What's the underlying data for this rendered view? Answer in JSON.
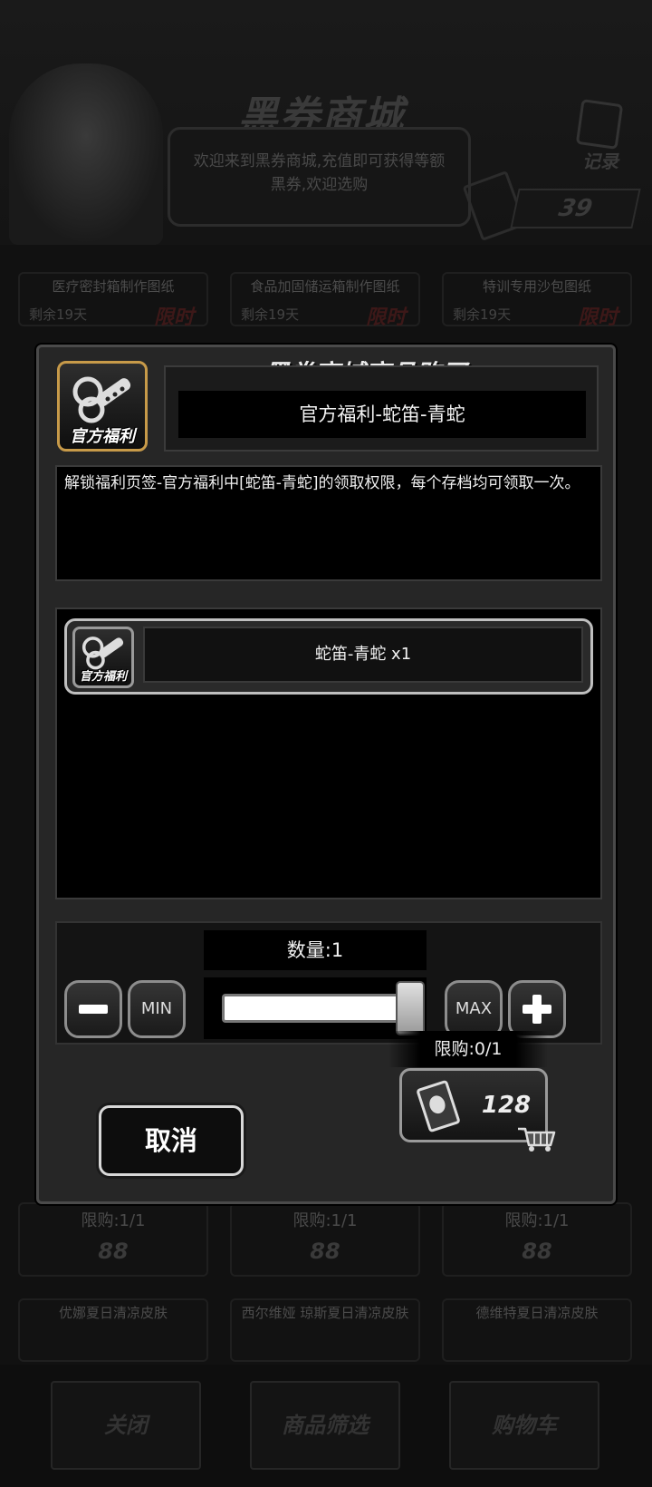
{
  "background": {
    "shop_title": "黑券商城",
    "welcome_text": "欢迎来到黑券商城,充值即可获得等额黑券,欢迎选购",
    "record_label": "记录",
    "ticket_balance": "39",
    "cards_row1": [
      {
        "title": "医疗密封箱制作图纸",
        "days": "剩余19天",
        "tag": "限时"
      },
      {
        "title": "食品加固储运箱制作图纸",
        "days": "剩余19天",
        "tag": "限时"
      },
      {
        "title": "特训专用沙包图纸",
        "days": "剩余19天",
        "tag": "限时"
      }
    ],
    "cards_price_row": [
      {
        "limit": "限购:1/1",
        "price": "88"
      },
      {
        "limit": "限购:1/1",
        "price": "88"
      },
      {
        "limit": "限购:1/1",
        "price": "88"
      }
    ],
    "cards_row_bottom": [
      {
        "title": "优娜夏日清凉皮肤"
      },
      {
        "title": "西尔维娅 琼斯夏日清凉皮肤"
      },
      {
        "title": "德维特夏日清凉皮肤"
      }
    ],
    "footer": {
      "close": "关闭",
      "filter": "商品筛选",
      "cart": "购物车"
    }
  },
  "dialog": {
    "title": "黑券商城商品购买",
    "item_icon_label": "官方福利",
    "item_name": "官方福利-蛇笛-青蛇",
    "description": "解锁福利页签-官方福利中[蛇笛-青蛇]的领取权限，每个存档均可领取一次。",
    "reward": {
      "icon_label": "官方福利",
      "name": "蛇笛-青蛇 x1"
    },
    "quantity_label": "数量:1",
    "min_label": "MIN",
    "max_label": "MAX",
    "slider_fraction": 1.0,
    "purchase_limit": "限购:0/1",
    "cancel_label": "取消",
    "price": "128"
  }
}
